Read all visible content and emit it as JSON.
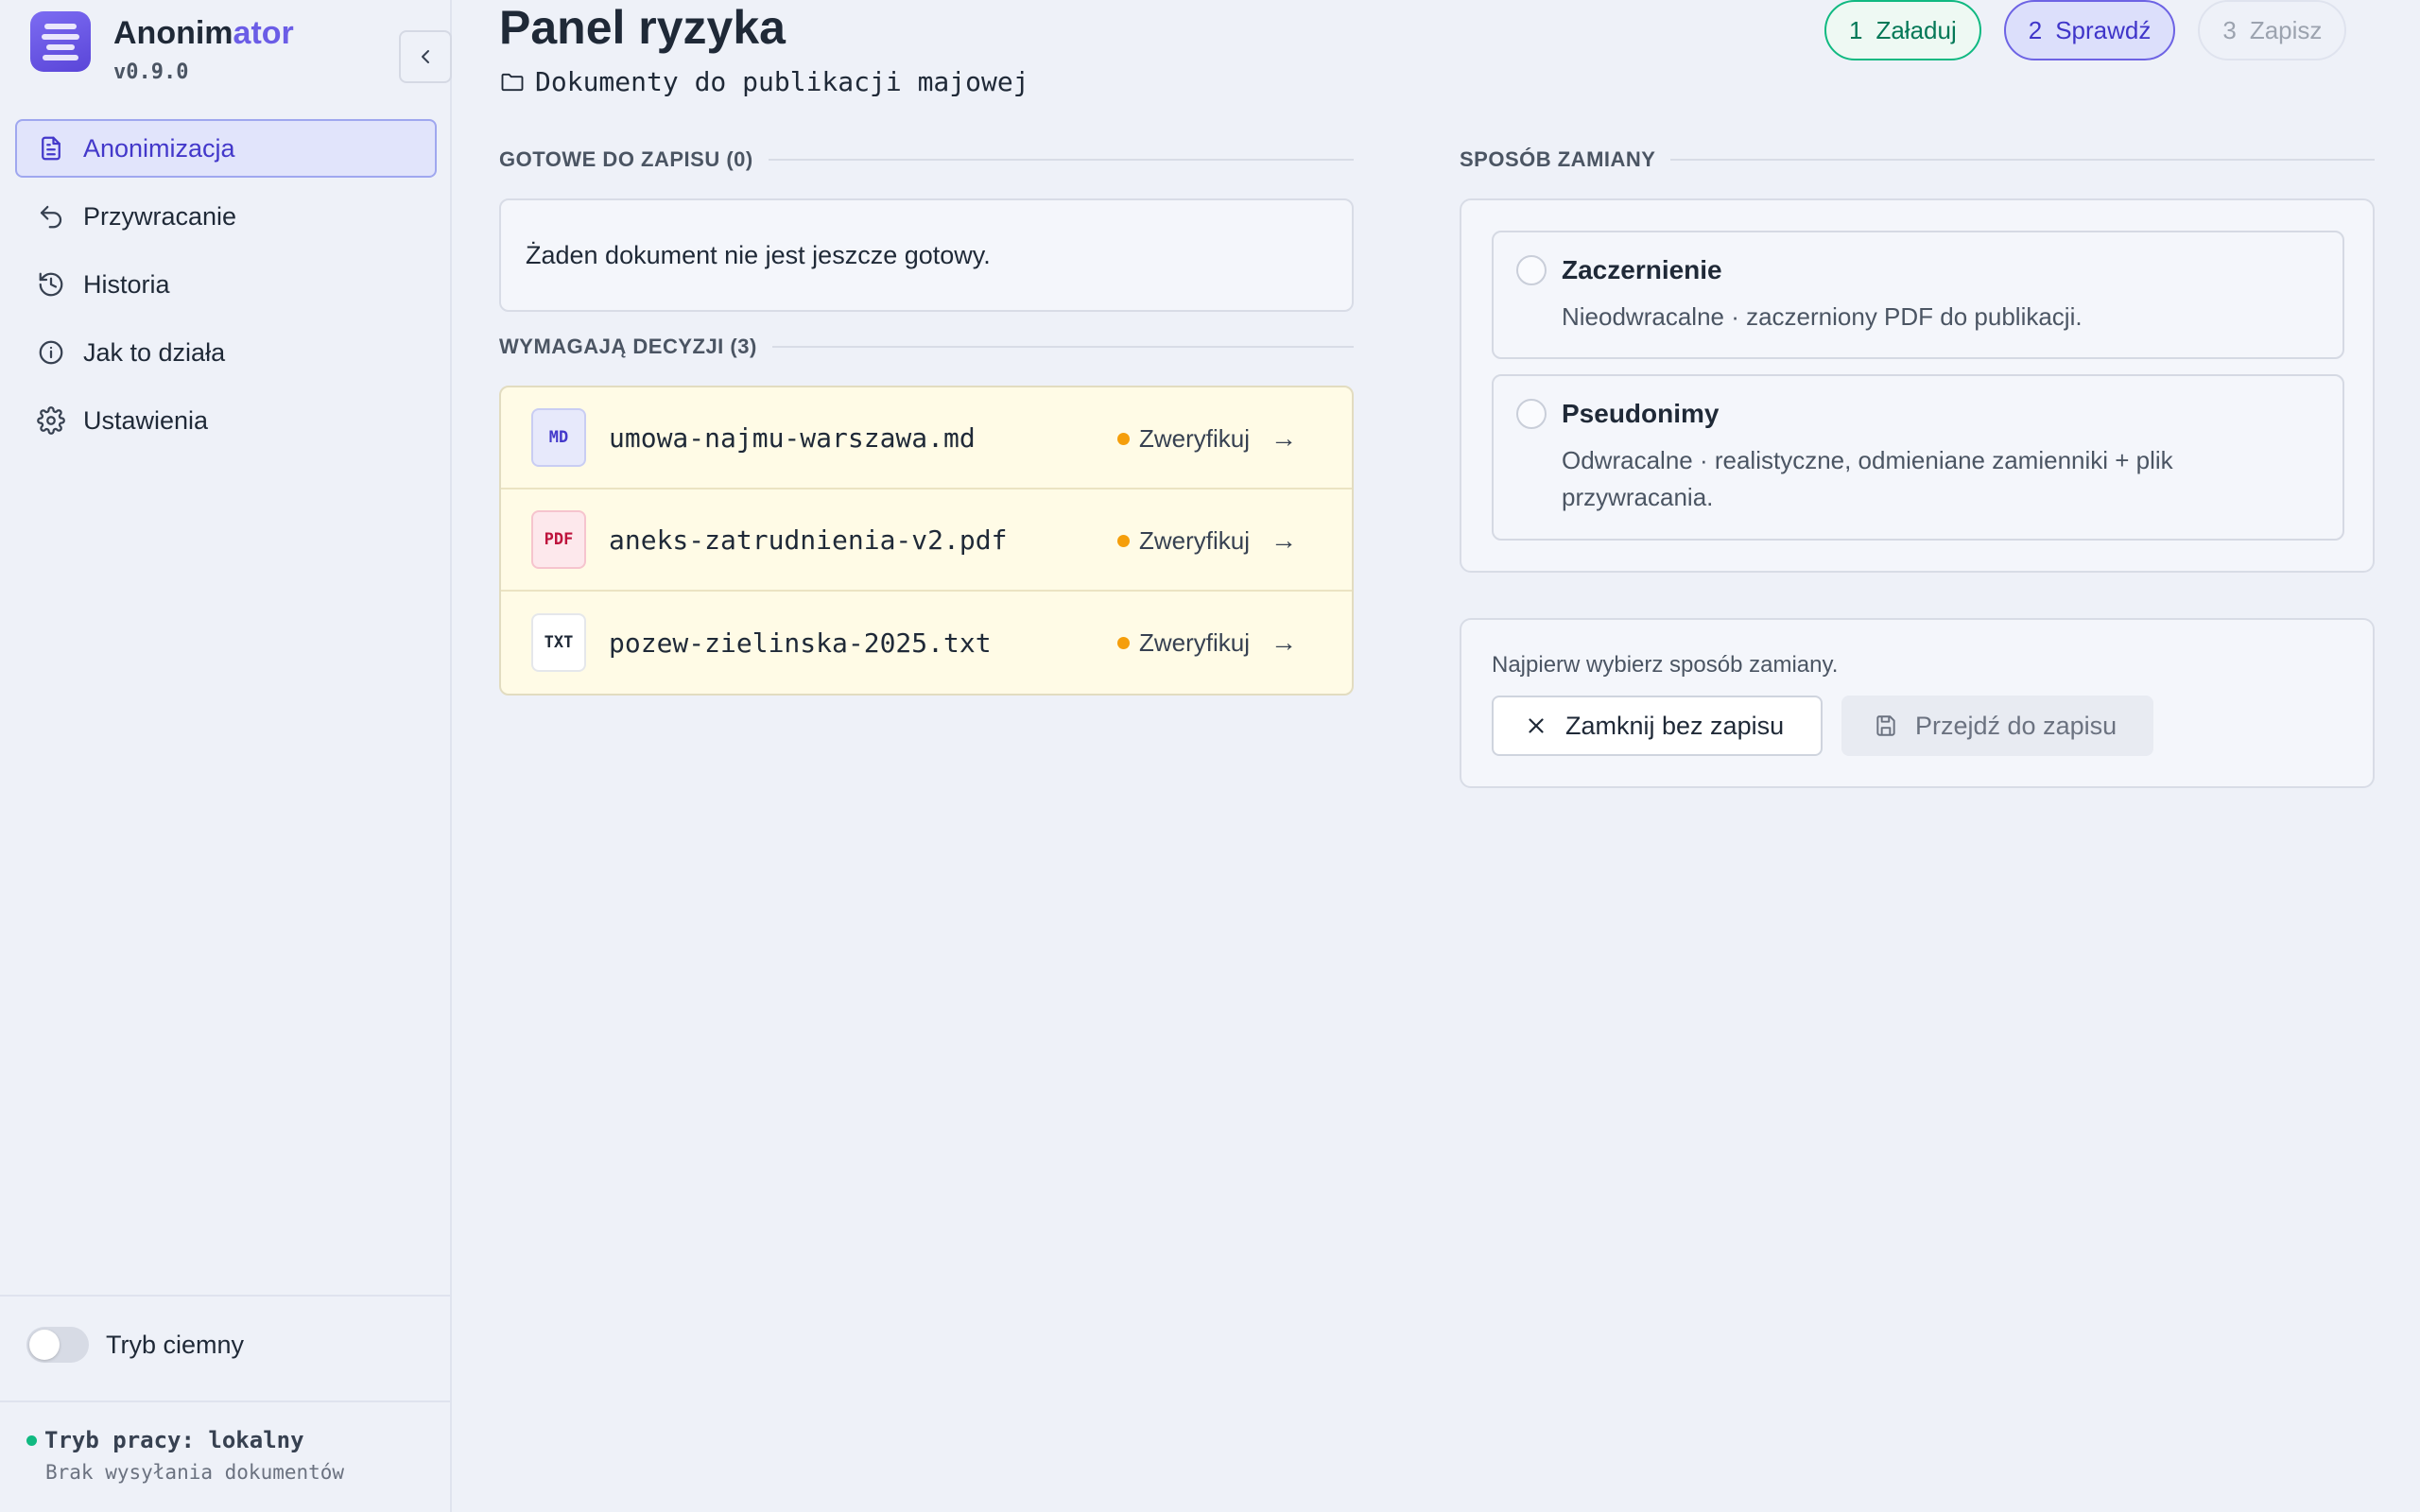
{
  "app": {
    "name_main": "Anonim",
    "name_accent": "ator",
    "version": "v0.9.0"
  },
  "sidebar": {
    "items": [
      {
        "label": "Anonimizacja",
        "icon": "document-icon",
        "active": true
      },
      {
        "label": "Przywracanie",
        "icon": "undo-arrow-icon",
        "active": false
      },
      {
        "label": "Historia",
        "icon": "history-icon",
        "active": false
      },
      {
        "label": "Jak to działa",
        "icon": "info-icon",
        "active": false
      },
      {
        "label": "Ustawienia",
        "icon": "gear-icon",
        "active": false
      }
    ],
    "dark_mode_label": "Tryb ciemny",
    "dark_mode_on": false,
    "work_mode": "Tryb pracy: lokalny",
    "work_mode_sub": "Brak wysyłania dokumentów"
  },
  "header": {
    "title": "Panel ryzyka",
    "folder": "Dokumenty do publikacji majowej"
  },
  "steps": [
    {
      "num": "1",
      "label": "Załaduj",
      "state": "done"
    },
    {
      "num": "2",
      "label": "Sprawdź",
      "state": "current"
    },
    {
      "num": "3",
      "label": "Zapisz",
      "state": "todo"
    }
  ],
  "ready": {
    "heading": "GOTOWE DO ZAPISU (0)",
    "empty_text": "Żaden dokument nie jest jeszcze gotowy."
  },
  "pending": {
    "heading": "WYMAGAJĄ DECYZJI (3)",
    "documents": [
      {
        "type": "MD",
        "name": "umowa-najmu-warszawa.md",
        "action": "Zweryfikuj"
      },
      {
        "type": "PDF",
        "name": "aneks-zatrudnienia-v2.pdf",
        "action": "Zweryfikuj"
      },
      {
        "type": "TXT",
        "name": "pozew-zielinska-2025.txt",
        "action": "Zweryfikuj"
      }
    ]
  },
  "method": {
    "heading": "SPOSÓB ZAMIANY",
    "options": [
      {
        "title": "Zaczernienie",
        "desc": "Nieodwracalne · zaczerniony PDF do publikacji."
      },
      {
        "title": "Pseudonimy",
        "desc": "Odwracalne · realistyczne, odmieniane zamienniki + plik przywracania."
      }
    ]
  },
  "actions": {
    "hint": "Najpierw wybierz sposób zamiany.",
    "close_label": "Zamknij bez zapisu",
    "next_label": "Przejdź do zapisu"
  },
  "colors": {
    "accent": "#6b5de6",
    "active_nav_bg": "#e1e4fb",
    "step_done": "#10b981",
    "pending_bg": "#fffbe6",
    "warning_dot": "#f59e0b"
  }
}
